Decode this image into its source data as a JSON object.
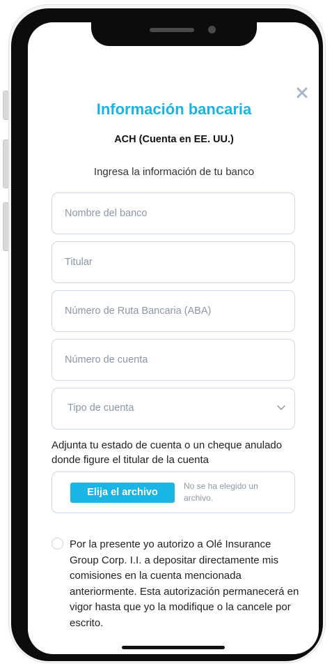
{
  "modal": {
    "title": "Información bancaria",
    "subtitle": "ACH (Cuenta en EE. UU.)",
    "instruction": "Ingresa la información de tu banco",
    "close_icon": "close-icon"
  },
  "form": {
    "bank_name_placeholder": "Nombre del banco",
    "holder_placeholder": "Titular",
    "routing_placeholder": "Número de Ruta Bancaria (ABA)",
    "account_number_placeholder": "Número de cuenta",
    "account_type_label": "Tipo de cuenta",
    "attach_instruction": "Adjunta tu estado de cuenta o un cheque anulado donde figure el titular de la cuenta",
    "file_button_label": "Elija el archivo",
    "file_status": "No se ha elegido un archivo.",
    "consent_text": "Por la presente yo autorizo a Olé Insurance Group Corp. I.I. a depositar directamente mis comisiones en la cuenta mencionada anteriormente. Esta autorización permanecerá en vigor hasta que yo la modifique o la cancele por escrito."
  },
  "colors": {
    "accent": "#1ab4e2",
    "button": "#19b5e5",
    "field_border": "#ccd8e8",
    "placeholder": "#8b97a6"
  }
}
